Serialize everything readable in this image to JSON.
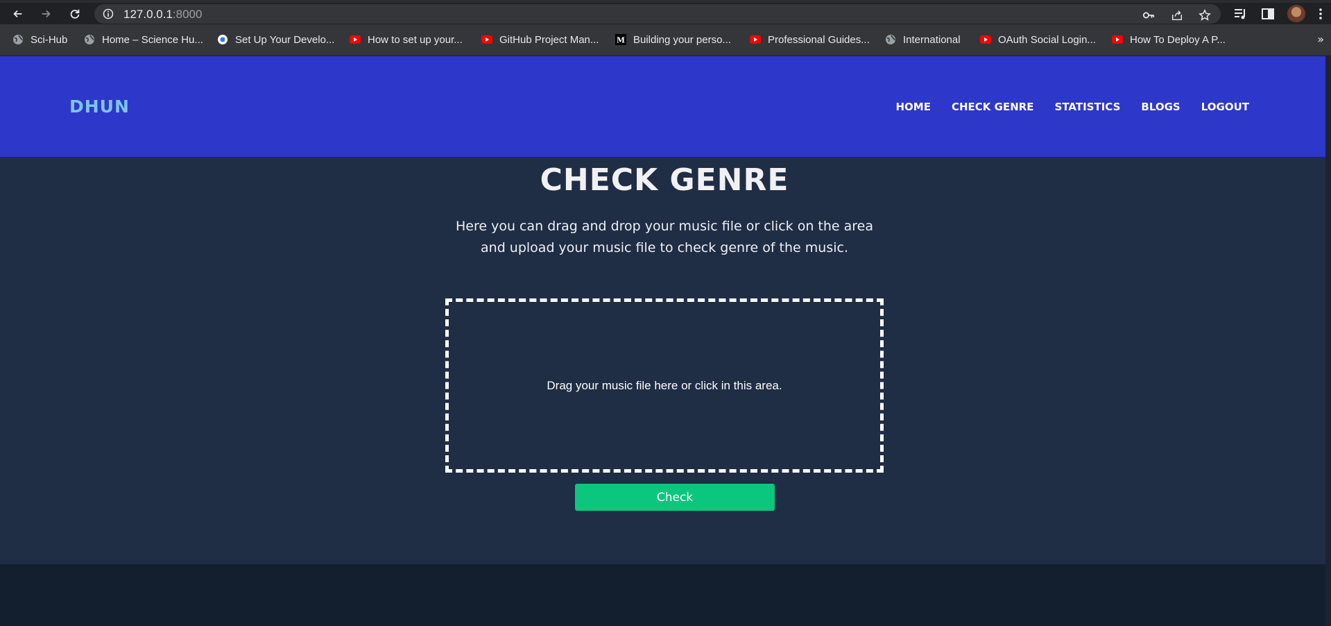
{
  "browser": {
    "url_host": "127.0.0.1",
    "url_port": ":8000",
    "icons": {
      "back": "arrow-left-icon",
      "forward": "arrow-right-icon",
      "reload": "reload-icon",
      "site_info": "info-icon",
      "password": "key-icon",
      "share": "share-icon",
      "bookmark": "star-icon",
      "media": "media-controls-icon",
      "side_panel": "side-panel-icon",
      "menu": "kebab-menu-icon"
    },
    "bookmarks": [
      {
        "label": "Sci-Hub",
        "icon": "globe-icon"
      },
      {
        "label": "Home – Science Hu...",
        "icon": "globe-icon"
      },
      {
        "label": "Set Up Your Develo...",
        "icon": "bookmark-favicon-icon"
      },
      {
        "label": "How to set up your...",
        "icon": "youtube-icon"
      },
      {
        "label": "GitHub Project Man...",
        "icon": "youtube-icon"
      },
      {
        "label": "Building your perso...",
        "icon": "medium-icon"
      },
      {
        "label": "Professional Guides...",
        "icon": "youtube-icon"
      },
      {
        "label": "International",
        "icon": "globe-icon"
      },
      {
        "label": "OAuth Social Login...",
        "icon": "youtube-icon"
      },
      {
        "label": "How To Deploy A P...",
        "icon": "youtube-icon"
      }
    ],
    "overflow": "»"
  },
  "site": {
    "brand": "DHUN",
    "nav": [
      "HOME",
      "CHECK GENRE",
      "STATISTICS",
      "BLOGS",
      "LOGOUT"
    ],
    "colors": {
      "header": "#2d37c9",
      "brand": "#7ec4f2",
      "main_bg": "#1f2d45",
      "button": "#0bc77e"
    }
  },
  "main": {
    "title": "CHECK GENRE",
    "intro_line1": "Here you can drag and drop your music file or click on the area",
    "intro_line2": "and upload your music file to check genre of the music.",
    "dropzone_text": "Drag your music file here or click in this area.",
    "check_button": "Check"
  }
}
